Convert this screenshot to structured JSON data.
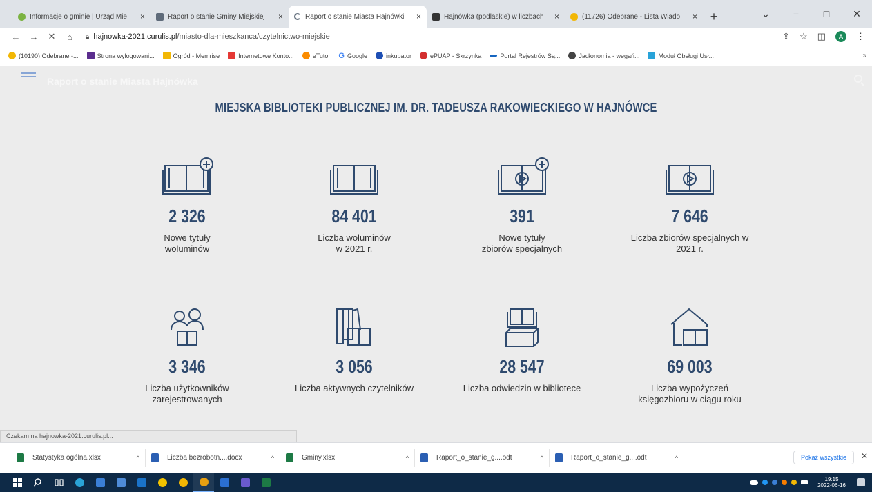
{
  "browser": {
    "tabs": [
      {
        "title": "Informacje o gminie | Urząd Mie",
        "icon": "globe-icon",
        "color": "#7cb342",
        "active": false
      },
      {
        "title": "Raport o stanie Gminy Miejskiej",
        "icon": "document-icon",
        "color": "#5f6b7a",
        "active": false
      },
      {
        "title": "Raport o stanie Miasta Hajnówki",
        "icon": "loading-icon",
        "color": "#dfe3e8",
        "active": true
      },
      {
        "title": "Hajnówka (podlaskie) w liczbach",
        "icon": "qr-icon",
        "color": "#333333",
        "active": false
      },
      {
        "title": "(11726) Odebrane - Lista Wiado",
        "icon": "mail-icon",
        "color": "#f2b705",
        "active": false
      }
    ],
    "tab_close": "×",
    "new_tab": "+",
    "window_controls": {
      "chevron": "⌄",
      "minimize": "−",
      "maximize": "□",
      "close": "✕"
    },
    "nav": {
      "back": "←",
      "forward": "→",
      "stop": "✕",
      "home": "⌂"
    },
    "url_host": "hajnowka-2021.curulis.pl",
    "url_path": "/miasto-dla-mieszkanca/czytelnictwo-miejskie",
    "tools": {
      "share": "⇪",
      "star": "☆",
      "sidepanel": "◫",
      "profile_initial": "A",
      "menu": "⋮"
    },
    "bookmarks": [
      {
        "label": "(10190) Odebrane -...",
        "color": "#f2b705"
      },
      {
        "label": "Strona wylogowani...",
        "color": "#5b2d8e"
      },
      {
        "label": "Ogród - Memrise",
        "color": "#f2b705"
      },
      {
        "label": "Internetowe Konto...",
        "color": "#e53935"
      },
      {
        "label": "eTutor",
        "color": "#fb8c00"
      },
      {
        "label": "Google",
        "color": "#4285f4"
      },
      {
        "label": "inkubator",
        "color": "#1e4fb4"
      },
      {
        "label": "ePUAP - Skrzynka",
        "color": "#d32f2f"
      },
      {
        "label": "Portal Rejestrów Są...",
        "color": "#1565c0"
      },
      {
        "label": "Jadłonomia - wegań...",
        "color": "#444444"
      },
      {
        "label": "Moduł Obsługi Usł...",
        "color": "#29a3d9"
      }
    ],
    "bookmarks_more": "»"
  },
  "page": {
    "site_title": "Raport o stanie Miasta Hajnówka",
    "heading": "MIEJSKA BIBLIOTEKI PUBLICZNEJ IM. DR. TADEUSZA RAKOWIECKIEGO W HAJNÓWCE",
    "accent": "#2f4a6e",
    "stats": [
      {
        "value": "2 326",
        "label": "Nowe tytuły\nwoluminów",
        "icon": "book-plus-icon"
      },
      {
        "value": "84 401",
        "label": "Liczba woluminów\nw 2021 r.",
        "icon": "open-book-icon"
      },
      {
        "value": "391",
        "label": "Nowe tytuły\nzbiorów specjalnych",
        "icon": "media-book-plus-icon"
      },
      {
        "value": "7 646",
        "label": "Liczba zbiorów specjalnych w\n2021 r.",
        "icon": "media-book-icon"
      },
      {
        "value": "3 346",
        "label": "Liczba użytkowników\nzarejestrowanych",
        "icon": "users-book-icon"
      },
      {
        "value": "3 056",
        "label": "Liczba aktywnych czytelników",
        "icon": "shelf-book-icon"
      },
      {
        "value": "28 547",
        "label": "Liczba odwiedzin w bibliotece",
        "icon": "box-book-icon"
      },
      {
        "value": "69 003",
        "label": "Liczba wypożyczeń\nksięgozbioru w ciągu roku",
        "icon": "house-book-icon"
      }
    ]
  },
  "status_text": "Czekam na hajnowka-2021.curulis.pl...",
  "downloads": {
    "items": [
      {
        "name": "Statystyka ogólna.xlsx",
        "color": "#1d7a45"
      },
      {
        "name": "Liczba bezrobotn....docx",
        "color": "#2b5fb3"
      },
      {
        "name": "Gminy.xlsx",
        "color": "#1d7a45"
      },
      {
        "name": "Raport_o_stanie_g....odt",
        "color": "#2b5fb3"
      },
      {
        "name": "Raport_o_stanie_g....odt",
        "color": "#2b5fb3"
      }
    ],
    "chevron": "^",
    "show_all": "Pokaż wszystkie",
    "close": "✕"
  },
  "taskbar": {
    "items": [
      {
        "name": "windows-start",
        "color": "#ffffff"
      },
      {
        "name": "search",
        "color": "#0e2a47"
      },
      {
        "name": "task-view",
        "color": "#0e2a47"
      },
      {
        "name": "edge",
        "color": "#2aa3d6"
      },
      {
        "name": "file-manager",
        "color": "#3b7fd6"
      },
      {
        "name": "calculator",
        "color": "#4f8cd8"
      },
      {
        "name": "mail",
        "color": "#1a73c9"
      },
      {
        "name": "app-yellow",
        "color": "#f2c200"
      },
      {
        "name": "chrome",
        "color": "#f2b705"
      },
      {
        "name": "chrome-active",
        "color": "#e8a010"
      },
      {
        "name": "word",
        "color": "#2b6fd1"
      },
      {
        "name": "app-grid",
        "color": "#6a5acd"
      },
      {
        "name": "excel",
        "color": "#1d7a45"
      }
    ],
    "tray_colors": [
      "#ffffff",
      "#2196f3",
      "#3b7fd6",
      "#f57c00",
      "#f2b705",
      "#ffffff"
    ],
    "clock_time": "19:15",
    "clock_date": "2022-06-16"
  }
}
